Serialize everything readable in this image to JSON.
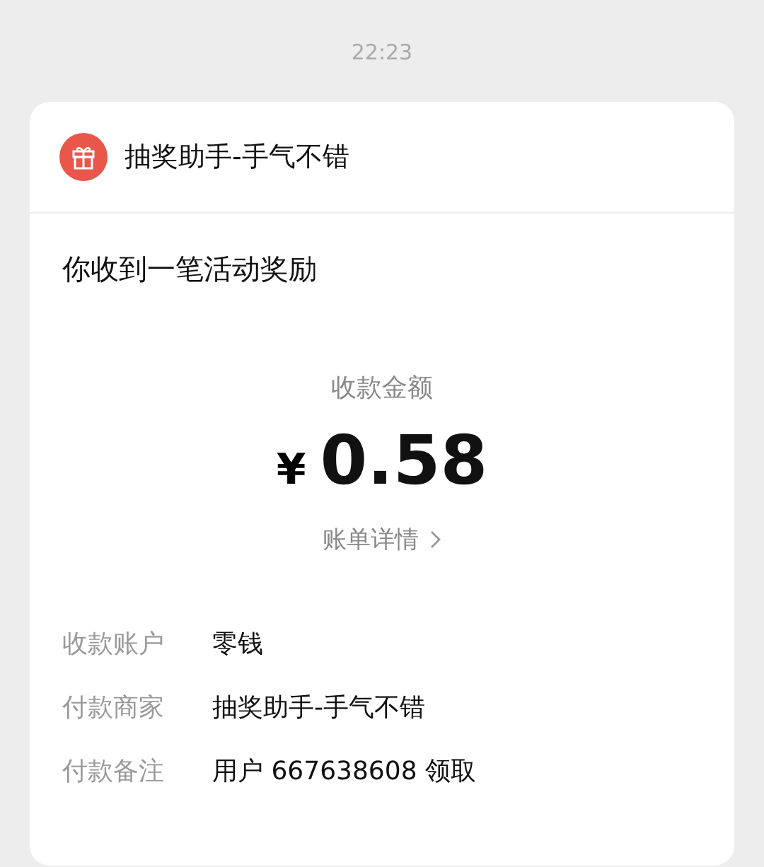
{
  "time": "22:23",
  "card": {
    "sender": "抽奖助手-手气不错",
    "headline": "你收到一笔活动奖励",
    "amount_label": "收款金额",
    "currency": "¥",
    "amount": "0.58",
    "details_link": "账单详情",
    "fields": [
      {
        "label": "收款账户",
        "value": "零钱"
      },
      {
        "label": "付款商家",
        "value": "抽奖助手-手气不错"
      },
      {
        "label": "付款备注",
        "value": "用户 667638608 领取"
      }
    ]
  }
}
